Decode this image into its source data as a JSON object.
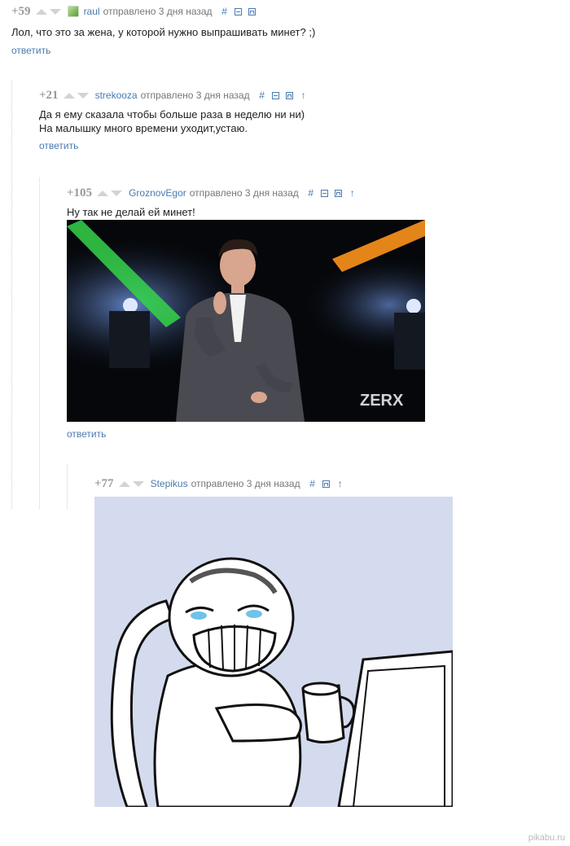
{
  "comments": [
    {
      "rating": "+59",
      "author": "raul",
      "sent": "отправлено 3 дня назад",
      "text": [
        "Лол, что это за жена, у которой нужно выпрашивать минет? ;)"
      ],
      "reply": "ответить"
    },
    {
      "rating": "+21",
      "author": "strekooza",
      "sent": "отправлено 3 дня назад",
      "text": [
        "Да я ему сказала чтобы больше раза в неделю ни ни)",
        "На малышку много времени уходит,устаю."
      ],
      "reply": "ответить"
    },
    {
      "rating": "+105",
      "author": "GroznovEgor",
      "sent": "отправлено 3 дня назад",
      "text": [
        "Ну так не делай ей минет!"
      ],
      "reply": "ответить",
      "image_logo": "ZERX"
    },
    {
      "rating": "+77",
      "author": "Stepikus",
      "sent": "отправлено 3 дня назад"
    }
  ],
  "tools": {
    "hash": "#"
  },
  "watermark": "pikabu.ru",
  "colors": {
    "link": "#4a7ab0",
    "meta": "#777777",
    "meme_bg": "#d5dbee"
  }
}
